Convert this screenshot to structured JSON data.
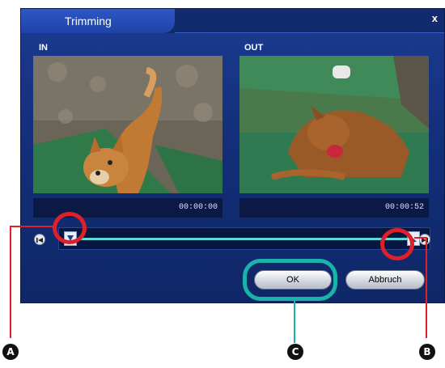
{
  "window": {
    "title": "Trimming",
    "close_label": "x"
  },
  "in_panel": {
    "label": "IN",
    "timecode": "00:00:00"
  },
  "out_panel": {
    "label": "OUT",
    "timecode": "00:00:52"
  },
  "buttons": {
    "ok": "OK",
    "cancel": "Abbruch"
  },
  "annotations": {
    "a": "A",
    "b": "B",
    "c": "C"
  },
  "colors": {
    "dialog_bg": "#14307c",
    "annotation_red": "#e02028",
    "annotation_teal": "#19b3aa",
    "track": "#5fd8d8"
  }
}
